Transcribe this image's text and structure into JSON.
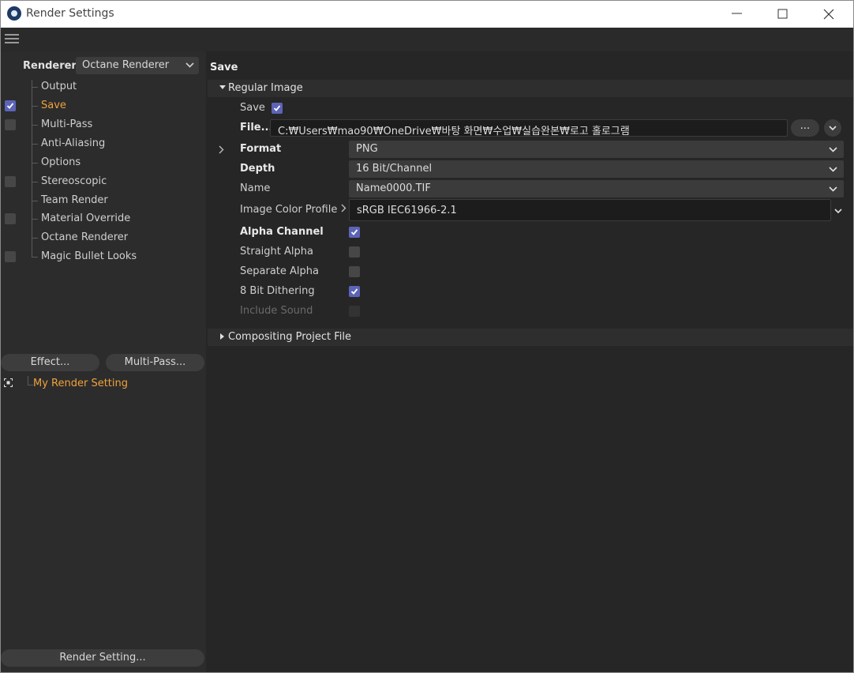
{
  "window": {
    "title": "Render Settings"
  },
  "left_panel": {
    "renderer_label": "Renderer",
    "renderer_value": "Octane Renderer",
    "tree": [
      {
        "label": "Output",
        "checkbox": "none",
        "active": false
      },
      {
        "label": "Save",
        "checkbox": "checked",
        "active": true
      },
      {
        "label": "Multi-Pass",
        "checkbox": "unchecked",
        "active": false
      },
      {
        "label": "Anti-Aliasing",
        "checkbox": "none",
        "active": false
      },
      {
        "label": "Options",
        "checkbox": "none",
        "active": false
      },
      {
        "label": "Stereoscopic",
        "checkbox": "unchecked",
        "active": false
      },
      {
        "label": "Team Render",
        "checkbox": "none",
        "active": false
      },
      {
        "label": "Material Override",
        "checkbox": "unchecked",
        "active": false
      },
      {
        "label": "Octane Renderer",
        "checkbox": "none",
        "active": false
      },
      {
        "label": "Magic Bullet Looks",
        "checkbox": "unchecked",
        "active": false
      }
    ],
    "effect_button": "Effect...",
    "multipass_button": "Multi-Pass...",
    "setting_name": "My Render Setting",
    "render_setting_button": "Render Setting..."
  },
  "main": {
    "section_title": "Save",
    "regular_image": {
      "header": "Regular Image",
      "save_label": "Save",
      "save_checked": true,
      "file_label": "File...",
      "file_path": "C:₩Users₩mao90₩OneDrive₩바탕 화면₩수업₩실습완본₩로고 홀로그램",
      "browse_button": "...",
      "format_label": "Format",
      "format_value": "PNG",
      "depth_label": "Depth",
      "depth_value": "16 Bit/Channel",
      "name_label": "Name",
      "name_value": "Name0000.TIF",
      "color_profile_label": "Image Color Profile",
      "color_profile_value": "sRGB IEC61966-2.1",
      "alpha_channel_label": "Alpha Channel",
      "alpha_channel_checked": true,
      "straight_alpha_label": "Straight Alpha",
      "straight_alpha_checked": false,
      "separate_alpha_label": "Separate Alpha",
      "separate_alpha_checked": false,
      "dithering_label": "8 Bit Dithering",
      "dithering_checked": true,
      "include_sound_label": "Include Sound",
      "include_sound_checked": false
    },
    "compositing": {
      "header": "Compositing Project File"
    }
  },
  "colors": {
    "accent_orange": "#f0a23c",
    "checkbox_checked": "#5c64b8",
    "panel_bg": "#2c2c2c",
    "main_bg": "#262626"
  },
  "icons": {
    "app": "cinema4d-logo-icon",
    "menu": "hamburger-menu-icon",
    "minimize": "minimize-icon",
    "maximize": "maximize-icon",
    "close": "close-icon",
    "dropdown": "chevron-down-icon",
    "expand": "chevron-right-icon",
    "collapse": "triangle-down-icon",
    "setting": "render-setting-icon"
  }
}
